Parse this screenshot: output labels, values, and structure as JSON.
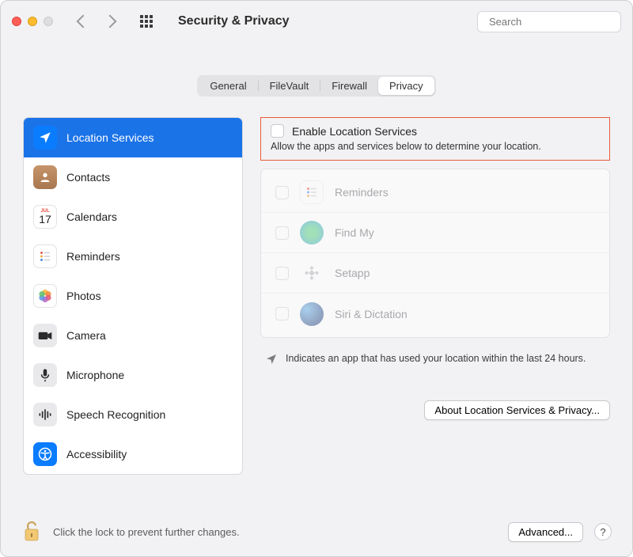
{
  "window": {
    "title": "Security & Privacy"
  },
  "search": {
    "placeholder": "Search"
  },
  "tabs": [
    {
      "label": "General"
    },
    {
      "label": "FileVault"
    },
    {
      "label": "Firewall"
    },
    {
      "label": "Privacy",
      "active": true
    }
  ],
  "sidebar": {
    "items": [
      {
        "label": "Location Services",
        "icon": "location",
        "active": true
      },
      {
        "label": "Contacts",
        "icon": "contacts"
      },
      {
        "label": "Calendars",
        "icon": "calendar",
        "badge": "17",
        "badgeTop": "JUL"
      },
      {
        "label": "Reminders",
        "icon": "reminders"
      },
      {
        "label": "Photos",
        "icon": "photos"
      },
      {
        "label": "Camera",
        "icon": "camera"
      },
      {
        "label": "Microphone",
        "icon": "microphone"
      },
      {
        "label": "Speech Recognition",
        "icon": "speech"
      },
      {
        "label": "Accessibility",
        "icon": "accessibility"
      }
    ]
  },
  "main": {
    "enable_label": "Enable Location Services",
    "enable_sub": "Allow the apps and services below to determine your location.",
    "apps": [
      {
        "label": "Reminders",
        "icon": "reminders"
      },
      {
        "label": "Find My",
        "icon": "findmy"
      },
      {
        "label": "Setapp",
        "icon": "setapp"
      },
      {
        "label": "Siri & Dictation",
        "icon": "siri"
      }
    ],
    "note": "Indicates an app that has used your location within the last 24 hours.",
    "about_btn": "About Location Services & Privacy..."
  },
  "footer": {
    "lock_text": "Click the lock to prevent further changes.",
    "advanced": "Advanced...",
    "help": "?"
  }
}
